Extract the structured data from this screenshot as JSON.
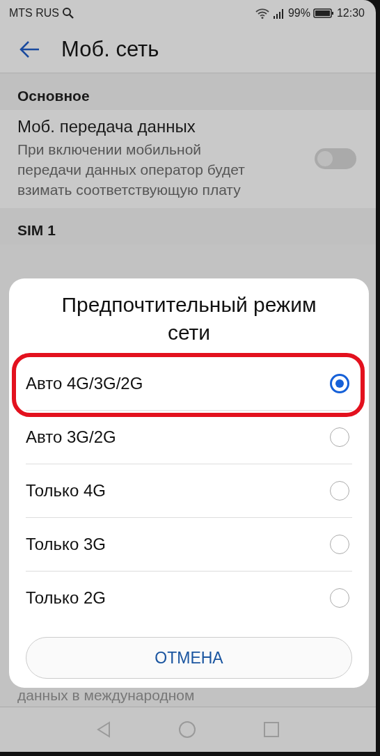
{
  "status_bar": {
    "carrier": "MTS RUS",
    "battery": "99%",
    "time": "12:30"
  },
  "header": {
    "title": "Моб. сеть"
  },
  "sections": [
    {
      "title": "Основное",
      "items": [
        {
          "title": "Моб. передача данных",
          "description": "При включении мобильной передачи данных оператор будет взимать соответствующую плату",
          "on": false
        }
      ]
    },
    {
      "title": "SIM 1"
    }
  ],
  "background_text": "данных в международном",
  "dialog": {
    "title": "Предпочтительный режим сети",
    "options": [
      {
        "label": "Авто 4G/3G/2G",
        "selected": true,
        "highlighted": true
      },
      {
        "label": "Авто 3G/2G",
        "selected": false,
        "highlighted": false
      },
      {
        "label": "Только 4G",
        "selected": false,
        "highlighted": false
      },
      {
        "label": "Только 3G",
        "selected": false,
        "highlighted": false
      },
      {
        "label": "Только 2G",
        "selected": false,
        "highlighted": false
      }
    ],
    "cancel": "ОТМЕНА"
  }
}
